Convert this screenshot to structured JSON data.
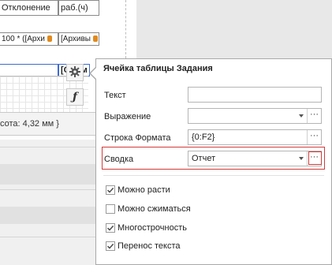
{
  "designer": {
    "header_cell_1": "Отклонение",
    "header_cell_2": "раб.(ч)",
    "expr_cell_1": "100 * ([Архи",
    "expr_cell_2": "[Архивы",
    "selected_cell_tail": "[Сумм",
    "status_text": "сота: 4,32 мм }"
  },
  "popup": {
    "title": "Ячейка таблицы Задания",
    "fields": [
      {
        "label": "Текст",
        "value": ""
      },
      {
        "label": "Выражение",
        "value": ""
      },
      {
        "label": "Строка Формата",
        "value": "{0:F2}"
      },
      {
        "label": "Сводка",
        "value": "Отчет"
      }
    ],
    "checkboxes": [
      {
        "label": "Можно расти",
        "checked": true
      },
      {
        "label": "Можно сжиматься",
        "checked": false
      },
      {
        "label": "Многострочность",
        "checked": true
      },
      {
        "label": "Перенос текста",
        "checked": true
      }
    ]
  },
  "icons": {
    "gear": "gear-icon",
    "formula": "function-icon",
    "ellipsis": "ellipsis-icon",
    "dropdown": "chevron-down-icon",
    "check": "check-icon"
  },
  "colors": {
    "highlight": "#d43a3a",
    "check": "#4a4a4a"
  }
}
